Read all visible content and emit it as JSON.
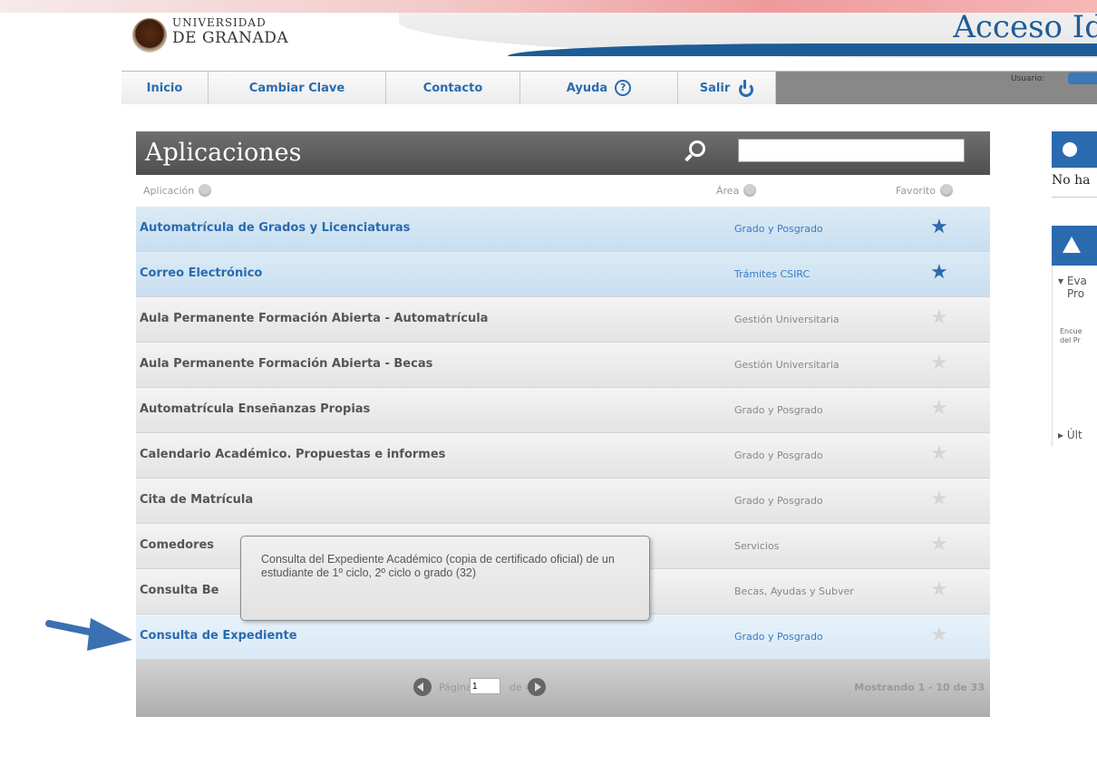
{
  "header": {
    "univ_line1": "UNIVERSIDAD",
    "univ_line2": "DE GRANADA",
    "acceso_title": "Acceso Id",
    "usuario_label": "Usuario:"
  },
  "nav": [
    {
      "label": "Inicio"
    },
    {
      "label": "Cambiar Clave"
    },
    {
      "label": "Contacto"
    },
    {
      "label": "Ayuda"
    },
    {
      "label": "Salir"
    }
  ],
  "panel": {
    "title": "Aplicaciones",
    "search_value": "",
    "col_app": "Aplicación",
    "col_area": "Área",
    "col_fav": "Favorito"
  },
  "rows": [
    {
      "name": "Automatrícula de Grados y Licenciaturas",
      "area": "Grado y Posgrado",
      "favorite": true
    },
    {
      "name": "Correo Electrónico",
      "area": "Trámites CSIRC",
      "favorite": true
    },
    {
      "name": "Aula Permanente Formación Abierta - Automatrícula",
      "area": "Gestión Universitaria",
      "favorite": false
    },
    {
      "name": "Aula Permanente Formación Abierta - Becas",
      "area": "Gestión Universitaria",
      "favorite": false
    },
    {
      "name": "Automatrícula Enseñanzas Propias",
      "area": "Grado y Posgrado",
      "favorite": false
    },
    {
      "name": "Calendario Académico. Propuestas e informes",
      "area": "Grado y Posgrado",
      "favorite": false
    },
    {
      "name": "Cita de Matrícula",
      "area": "Grado y Posgrado",
      "favorite": false
    },
    {
      "name": "Comedores",
      "area": "Servicios",
      "favorite": false
    },
    {
      "name": "Consulta Be",
      "area": "Becas, Ayudas y Subver",
      "favorite": false
    },
    {
      "name": "Consulta de Expediente",
      "area": "Grado y Posgrado",
      "favorite": false
    }
  ],
  "tooltip": {
    "text": "Consulta del Expediente Académico (copia de certificado oficial) de un estudiante de 1º ciclo, 2º ciclo o grado (32)"
  },
  "pager": {
    "pagina_label": "Página",
    "page_value": "1",
    "of_label": "de 4",
    "showing": "Mostrando 1 - 10 de 33"
  },
  "side": {
    "no_hay": "No ha",
    "item1_line1": "Eva",
    "item1_line2": "Pro",
    "small_line1": "Encue",
    "small_line2": "del Pr",
    "ultimo": "Últ"
  },
  "icons": {
    "help": "help-circle-icon",
    "power": "power-icon",
    "search": "search-icon",
    "star": "star-icon",
    "warning": "warning-icon"
  },
  "colors": {
    "brand_blue": "#2a6bb0",
    "header_gray": "#5f5f5f",
    "favorite_row": "#d3e6f3"
  }
}
